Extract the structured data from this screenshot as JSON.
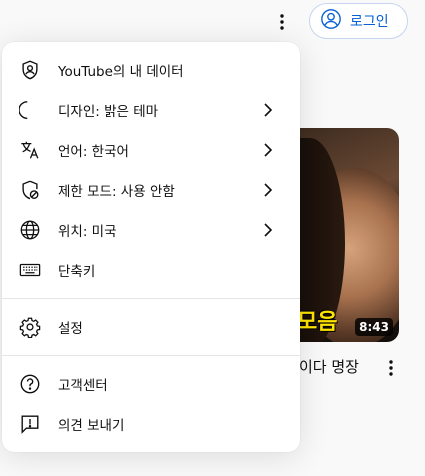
{
  "topbar": {
    "more_icon": "more-vert-icon",
    "login_label": "로그인",
    "login_icon": "account-circle-icon"
  },
  "video": {
    "caption": "모음",
    "duration": "8:43",
    "title_fragment": "이다 명장"
  },
  "menu": {
    "items": [
      {
        "icon": "account-shield-icon",
        "label": "YouTube의 내 데이터",
        "chevron": false
      },
      {
        "icon": "moon-icon",
        "label": "디자인: 밝은 테마",
        "chevron": true
      },
      {
        "icon": "translate-icon",
        "label": "언어: 한국어",
        "chevron": true
      },
      {
        "icon": "restricted-mode-icon",
        "label": "제한 모드: 사용 안함",
        "chevron": true
      },
      {
        "icon": "globe-icon",
        "label": "위치: 미국",
        "chevron": true
      },
      {
        "icon": "keyboard-icon",
        "label": "단축키",
        "chevron": false
      }
    ],
    "settings": {
      "icon": "gear-icon",
      "label": "설정"
    },
    "help": [
      {
        "icon": "help-icon",
        "label": "고객센터"
      },
      {
        "icon": "feedback-icon",
        "label": "의견 보내기"
      }
    ]
  }
}
